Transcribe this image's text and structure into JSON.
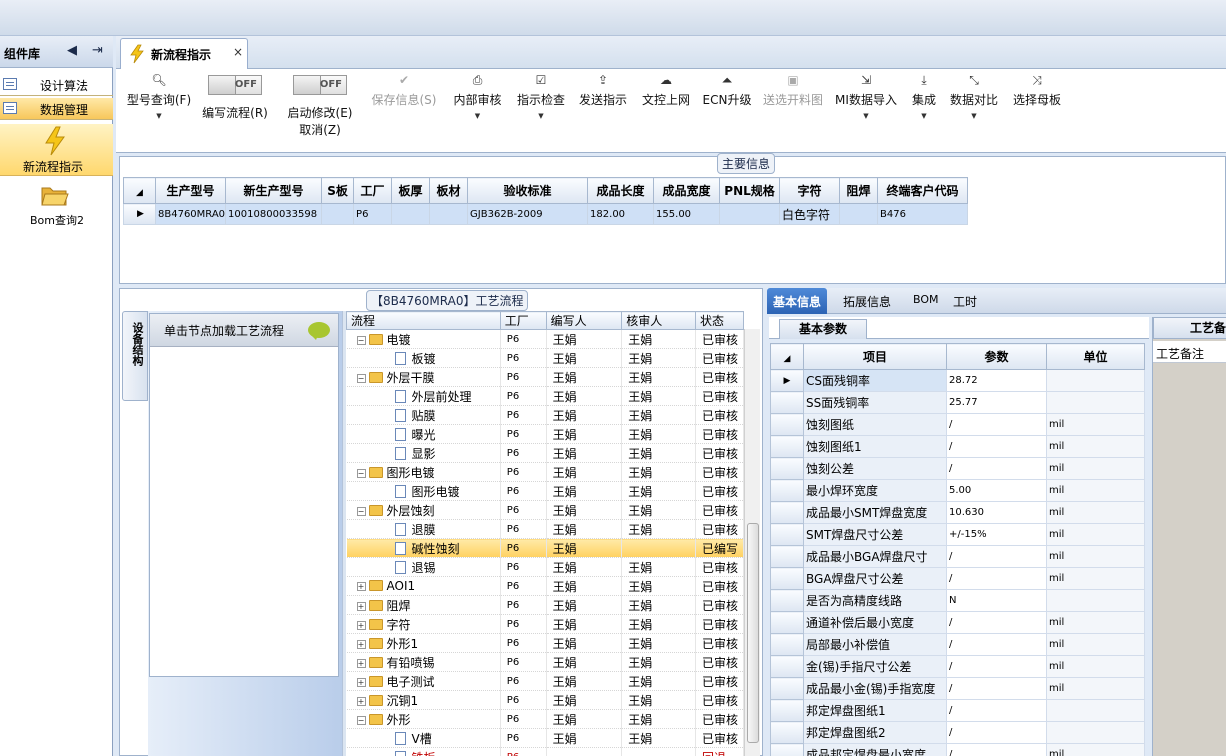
{
  "left_panel": {
    "title": "组件库",
    "items": [
      {
        "label": "设计算法"
      },
      {
        "label": "数据管理"
      },
      {
        "label": "新流程指示"
      },
      {
        "label": "Bom查询2"
      }
    ]
  },
  "tab": {
    "label": "新流程指示",
    "close": "×"
  },
  "ribbon": {
    "toggle_off": "OFF",
    "items": [
      {
        "label": "型号查询(F)"
      },
      {
        "label": "编写流程(R)"
      },
      {
        "label": "启动修改(E)",
        "label2": "取消(Z)"
      },
      {
        "label": "保存信息(S)"
      },
      {
        "label": "内部审核"
      },
      {
        "label": "指示检查"
      },
      {
        "label": "发送指示"
      },
      {
        "label": "文控上网"
      },
      {
        "label": "ECN升级"
      },
      {
        "label": "送选开料图"
      },
      {
        "label": "MI数据导入"
      },
      {
        "label": "集成"
      },
      {
        "label": "数据对比"
      },
      {
        "label": "选择母板"
      }
    ]
  },
  "main_info": {
    "title": "主要信息",
    "columns": [
      "生产型号",
      "新生产型号",
      "S板",
      "工厂",
      "板厚",
      "板材",
      "验收标准",
      "成品长度",
      "成品宽度",
      "PNL规格",
      "字符",
      "阻焊",
      "终端客户代码"
    ],
    "row": [
      "8B4760MRA0",
      "10010800033598",
      "",
      "P6",
      "",
      "",
      "GJB362B-2009",
      "182.00",
      "155.00",
      "",
      "白色字符",
      "",
      "B476"
    ]
  },
  "process": {
    "title": "【8B4760MRA0】工艺流程",
    "vtab": "设备结构",
    "node_hint": "单击节点加载工艺流程",
    "columns": [
      "流程",
      "工厂",
      "编写人",
      "核审人",
      "状态"
    ],
    "rows": [
      {
        "level": 1,
        "type": "folder",
        "name": "电镀",
        "factory": "P6",
        "writer": "王娟",
        "reviewer": "王娟",
        "status": "已审核"
      },
      {
        "level": 2,
        "type": "doc",
        "name": "板镀",
        "factory": "P6",
        "writer": "王娟",
        "reviewer": "王娟",
        "status": "已审核"
      },
      {
        "level": 1,
        "type": "folder",
        "name": "外层干膜",
        "factory": "P6",
        "writer": "王娟",
        "reviewer": "王娟",
        "status": "已审核"
      },
      {
        "level": 2,
        "type": "doc",
        "name": "外层前处理",
        "factory": "P6",
        "writer": "王娟",
        "reviewer": "王娟",
        "status": "已审核"
      },
      {
        "level": 2,
        "type": "doc",
        "name": "贴膜",
        "factory": "P6",
        "writer": "王娟",
        "reviewer": "王娟",
        "status": "已审核"
      },
      {
        "level": 2,
        "type": "doc",
        "name": "曝光",
        "factory": "P6",
        "writer": "王娟",
        "reviewer": "王娟",
        "status": "已审核"
      },
      {
        "level": 2,
        "type": "doc",
        "name": "显影",
        "factory": "P6",
        "writer": "王娟",
        "reviewer": "王娟",
        "status": "已审核"
      },
      {
        "level": 1,
        "type": "folder",
        "name": "图形电镀",
        "factory": "P6",
        "writer": "王娟",
        "reviewer": "王娟",
        "status": "已审核"
      },
      {
        "level": 2,
        "type": "doc",
        "name": "图形电镀",
        "factory": "P6",
        "writer": "王娟",
        "reviewer": "王娟",
        "status": "已审核"
      },
      {
        "level": 1,
        "type": "folder",
        "name": "外层蚀刻",
        "factory": "P6",
        "writer": "王娟",
        "reviewer": "王娟",
        "status": "已审核"
      },
      {
        "level": 2,
        "type": "doc",
        "name": "退膜",
        "factory": "P6",
        "writer": "王娟",
        "reviewer": "王娟",
        "status": "已审核"
      },
      {
        "level": 2,
        "type": "doc",
        "name": "碱性蚀刻",
        "factory": "P6",
        "writer": "王娟",
        "reviewer": "",
        "status": "已编写",
        "selected": true
      },
      {
        "level": 2,
        "type": "doc",
        "name": "退锡",
        "factory": "P6",
        "writer": "王娟",
        "reviewer": "王娟",
        "status": "已审核"
      },
      {
        "level": 1,
        "type": "folder-collapsed",
        "name": "AOI1",
        "factory": "P6",
        "writer": "王娟",
        "reviewer": "王娟",
        "status": "已审核"
      },
      {
        "level": 1,
        "type": "folder-collapsed",
        "name": "阻焊",
        "factory": "P6",
        "writer": "王娟",
        "reviewer": "王娟",
        "status": "已审核"
      },
      {
        "level": 1,
        "type": "folder-collapsed",
        "name": "字符",
        "factory": "P6",
        "writer": "王娟",
        "reviewer": "王娟",
        "status": "已审核"
      },
      {
        "level": 1,
        "type": "folder-collapsed",
        "name": "外形1",
        "factory": "P6",
        "writer": "王娟",
        "reviewer": "王娟",
        "status": "已审核"
      },
      {
        "level": 1,
        "type": "folder-collapsed",
        "name": "有铅喷锡",
        "factory": "P6",
        "writer": "王娟",
        "reviewer": "王娟",
        "status": "已审核"
      },
      {
        "level": 1,
        "type": "folder-collapsed",
        "name": "电子测试",
        "factory": "P6",
        "writer": "王娟",
        "reviewer": "王娟",
        "status": "已审核"
      },
      {
        "level": 1,
        "type": "folder-collapsed",
        "name": "沉铜1",
        "factory": "P6",
        "writer": "王娟",
        "reviewer": "王娟",
        "status": "已审核"
      },
      {
        "level": 1,
        "type": "folder",
        "name": "外形",
        "factory": "P6",
        "writer": "王娟",
        "reviewer": "王娟",
        "status": "已审核"
      },
      {
        "level": 2,
        "type": "doc",
        "name": "V槽",
        "factory": "P6",
        "writer": "王娟",
        "reviewer": "王娟",
        "status": "已审核"
      },
      {
        "level": 2,
        "type": "doc",
        "name": "铣板",
        "factory": "P6",
        "writer": "",
        "reviewer": "",
        "status": "回退",
        "red": true
      }
    ]
  },
  "right": {
    "tabs": [
      "基本信息",
      "拓展信息",
      "BOM",
      "工时"
    ],
    "param_tab": "基本参数",
    "side_tab": "工艺备注",
    "side_header": "工艺备注",
    "columns": [
      "项目",
      "参数",
      "单位"
    ],
    "rows": [
      {
        "item": "CS面残铜率",
        "value": "28.72",
        "unit": ""
      },
      {
        "item": "SS面残铜率",
        "value": "25.77",
        "unit": ""
      },
      {
        "item": "蚀刻图纸",
        "value": "/",
        "unit": "mil"
      },
      {
        "item": "蚀刻图纸1",
        "value": "/",
        "unit": "mil"
      },
      {
        "item": "蚀刻公差",
        "value": "/",
        "unit": "mil"
      },
      {
        "item": "最小焊环宽度",
        "value": "5.00",
        "unit": "mil"
      },
      {
        "item": "成品最小SMT焊盘宽度",
        "value": "10.630",
        "unit": "mil"
      },
      {
        "item": "SMT焊盘尺寸公差",
        "value": "+/-15%",
        "unit": "mil"
      },
      {
        "item": "成品最小BGA焊盘尺寸",
        "value": "/",
        "unit": "mil"
      },
      {
        "item": "BGA焊盘尺寸公差",
        "value": "/",
        "unit": "mil"
      },
      {
        "item": "是否为高精度线路",
        "value": "N",
        "unit": ""
      },
      {
        "item": "通道补偿后最小宽度",
        "value": "/",
        "unit": "mil"
      },
      {
        "item": "局部最小补偿值",
        "value": "/",
        "unit": "mil"
      },
      {
        "item": "金(锡)手指尺寸公差",
        "value": "/",
        "unit": "mil"
      },
      {
        "item": "成品最小金(锡)手指宽度",
        "value": "/",
        "unit": "mil"
      },
      {
        "item": "邦定焊盘图纸1",
        "value": "/",
        "unit": ""
      },
      {
        "item": "邦定焊盘图纸2",
        "value": "/",
        "unit": ""
      },
      {
        "item": "成品邦定焊盘最小宽度",
        "value": "/",
        "unit": "mil"
      }
    ]
  }
}
